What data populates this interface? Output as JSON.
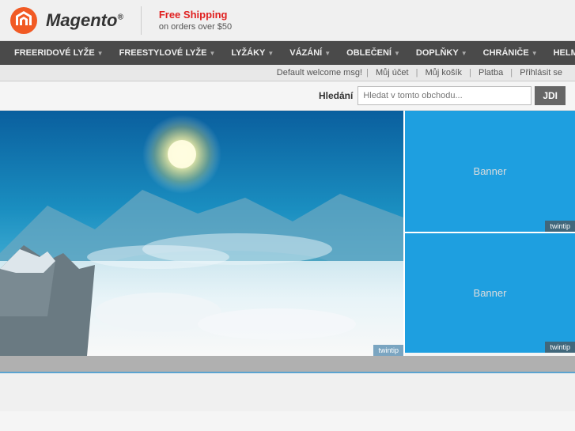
{
  "header": {
    "logo_text": "Magento",
    "logo_reg": "®",
    "free_shipping_label": "Free Shipping",
    "free_shipping_sub": "on orders over $50"
  },
  "nav": {
    "items": [
      {
        "label": "FREERIDOVÉ LYŽE",
        "has_arrow": true
      },
      {
        "label": "FREESTYLOVÉ LYŽE",
        "has_arrow": true
      },
      {
        "label": "LYŽÁKY",
        "has_arrow": true
      },
      {
        "label": "VÁZÁNÍ",
        "has_arrow": true
      },
      {
        "label": "OBLEČENÍ",
        "has_arrow": true
      },
      {
        "label": "DOPLŇKY",
        "has_arrow": true
      },
      {
        "label": "CHRÁNIČE",
        "has_arrow": true
      },
      {
        "label": "HELMY",
        "has_arrow": true
      }
    ]
  },
  "welcome_bar": {
    "welcome_msg": "Default welcome msg!",
    "links": [
      "Můj účet",
      "Můj košík",
      "Platba",
      "Přihlásit se"
    ]
  },
  "search": {
    "label": "Hledání",
    "placeholder": "Hledat v tomto obchodu...",
    "button_label": "JDI"
  },
  "banners": {
    "main_label": "twintip",
    "right_top": {
      "text": "Banner",
      "label": "twintip"
    },
    "right_bottom": {
      "text": "Banner",
      "label": "twintip"
    }
  }
}
